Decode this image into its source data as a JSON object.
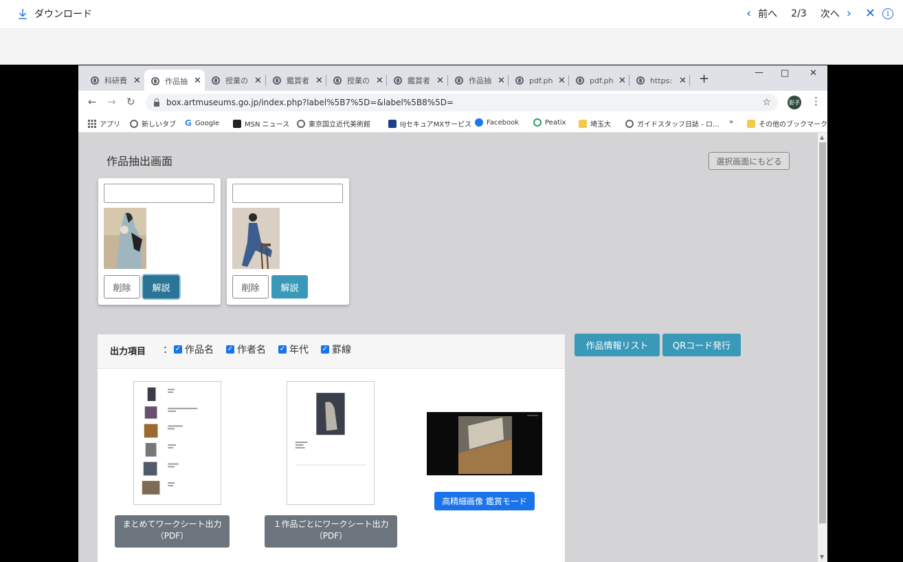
{
  "viewer": {
    "download_label": "ダウンロード",
    "prev_label": "前へ",
    "page_indicator": "2/3",
    "next_label": "次へ",
    "info_glyph": "i"
  },
  "browser": {
    "tabs": [
      {
        "title": "科研費"
      },
      {
        "title": "作品抽"
      },
      {
        "title": "授業の"
      },
      {
        "title": "鑑賞者"
      },
      {
        "title": "授業の"
      },
      {
        "title": "鑑賞者"
      },
      {
        "title": "作品抽"
      },
      {
        "title": "pdf.ph"
      },
      {
        "title": "pdf.ph"
      },
      {
        "title": "https:"
      }
    ],
    "url": "box.artmuseums.go.jp/index.php?label%5B7%5D=&label%5B8%5D=",
    "avatar_text": "彰子",
    "bookmarks": [
      "アプリ",
      "新しいタブ",
      "Google",
      "MSN ニュース",
      "東京国立近代美術館",
      "IIJセキュアMXサービス",
      "Facebook",
      "Peatix",
      "埼玉大",
      "ガイドスタッフ日誌 - ロ...",
      "»",
      "その他のブックマーク"
    ]
  },
  "page": {
    "title": "作品抽出画面",
    "back_button": "選択画面にもどる",
    "cards": [
      {
        "input_value": "",
        "delete_label": "削除",
        "explain_label": "解説"
      },
      {
        "input_value": "",
        "delete_label": "削除",
        "explain_label": "解説"
      }
    ],
    "output": {
      "label": "出力項目",
      "separator": "：",
      "options": [
        "作品名",
        "作者名",
        "年代",
        "罫線"
      ]
    },
    "buttons": {
      "work_list": "作品情報リスト",
      "qr": "QRコード発行",
      "combined_sheet": "まとめてワークシート出力",
      "combined_sheet_fmt": "（PDF）",
      "per_work_sheet": "１作品ごとにワークシート出力",
      "per_work_sheet_fmt": "（PDF）",
      "hires_mode": "高精細画像 鑑賞モード"
    }
  },
  "colors": {
    "accent_teal": "#3a98b8",
    "accent_blue": "#1a73e8",
    "gray_button": "#6c757d",
    "viewer_icon": "#1a6ad8"
  }
}
